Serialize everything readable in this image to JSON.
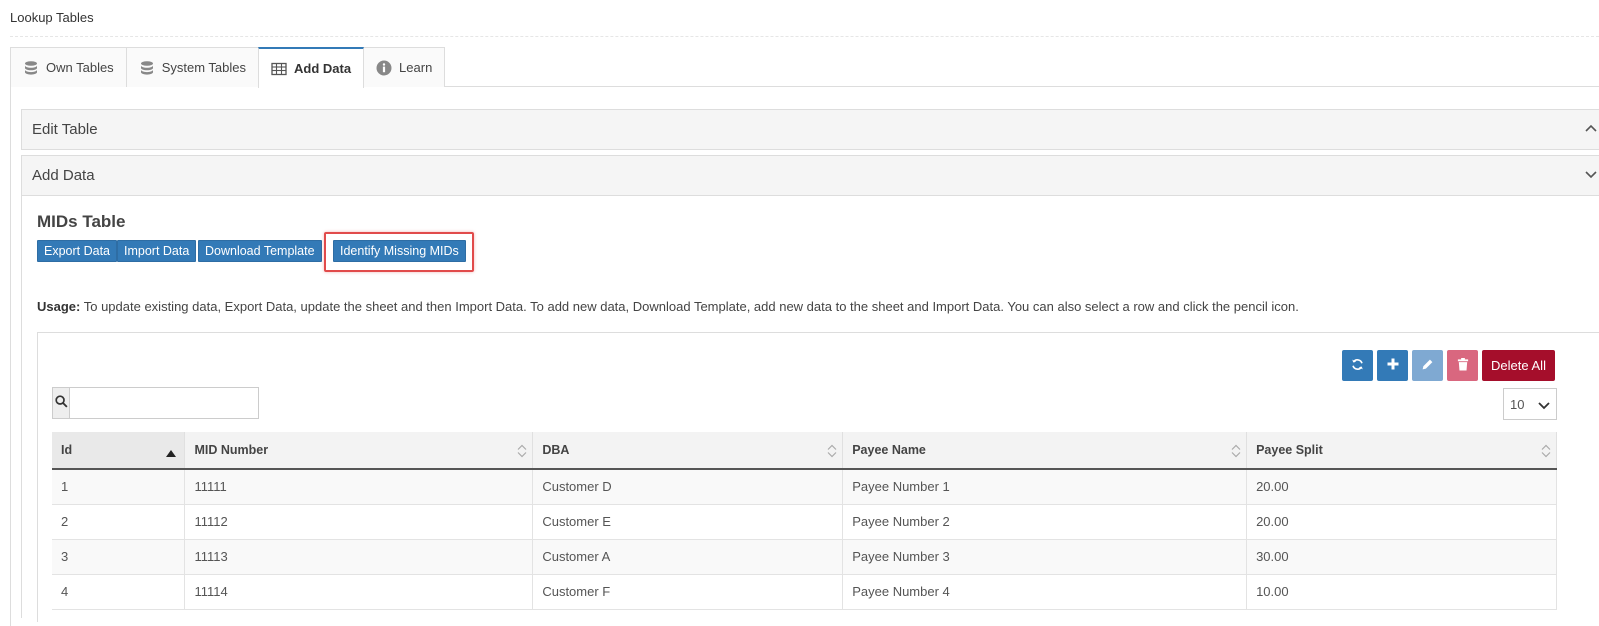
{
  "page": {
    "title": "Lookup Tables"
  },
  "tabs": [
    {
      "label": "Own Tables",
      "icon": "database-icon",
      "active": false
    },
    {
      "label": "System Tables",
      "icon": "database-icon",
      "active": false
    },
    {
      "label": "Add Data",
      "icon": "table-icon",
      "active": true
    },
    {
      "label": "Learn",
      "icon": "info-icon",
      "active": false
    }
  ],
  "accordion": {
    "edit_table": {
      "label": "Edit Table",
      "state": "collapsed",
      "icon": "chevron-up-icon"
    },
    "add_data": {
      "label": "Add Data",
      "state": "expanded",
      "icon": "chevron-down-icon"
    }
  },
  "section": {
    "title": "MIDs Table",
    "buttons": {
      "export": "Export Data",
      "import": "Import Data",
      "download": "Download Template",
      "identify": "Identify Missing MIDs"
    },
    "usage_label": "Usage:",
    "usage_text": " To update existing data, Export Data, update the sheet and then Import Data. To add new data, Download Template, add new data to the sheet and Import Data. You can also select a row and click the pencil icon."
  },
  "toolbar": {
    "refresh_icon": "refresh-icon",
    "add_icon": "plus-icon",
    "edit_icon": "pencil-icon",
    "delete_icon": "trash-icon",
    "delete_all_label": "Delete All",
    "colors": {
      "primary": "#337ab7",
      "edit": "#7fa9d2",
      "delete": "#d9677f",
      "delete_all": "#a50e2b"
    }
  },
  "search": {
    "value": "",
    "placeholder": ""
  },
  "page_size": {
    "value": "10"
  },
  "grid": {
    "columns": [
      "Id",
      "MID Number",
      "DBA",
      "Payee Name",
      "Payee Split"
    ],
    "sorted_column": "Id",
    "sort_direction": "asc",
    "rows": [
      [
        "1",
        "11111",
        "Customer D",
        "Payee Number 1",
        "20.00"
      ],
      [
        "2",
        "11112",
        "Customer E",
        "Payee Number 2",
        "20.00"
      ],
      [
        "3",
        "11113",
        "Customer A",
        "Payee Number 3",
        "30.00"
      ],
      [
        "4",
        "11114",
        "Customer F",
        "Payee Number 4",
        "10.00"
      ]
    ]
  }
}
